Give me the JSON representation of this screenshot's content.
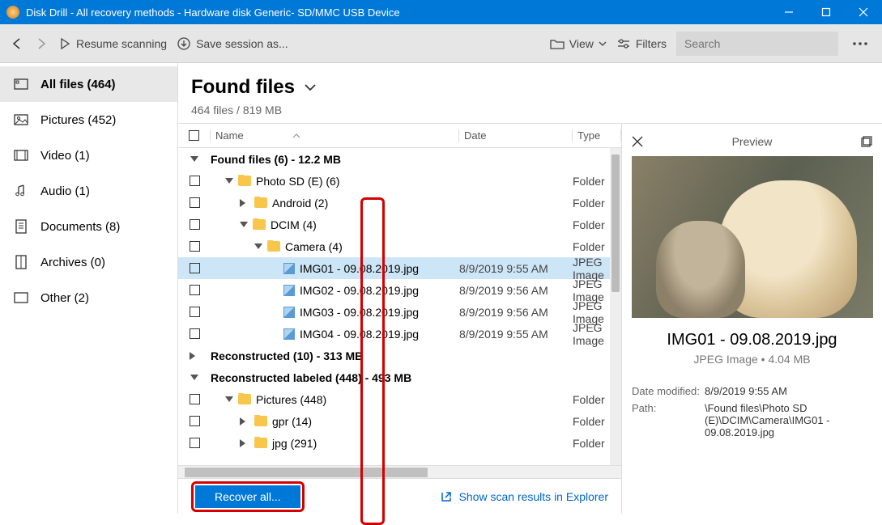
{
  "titlebar": {
    "title": "Disk Drill - All recovery methods - Hardware disk Generic- SD/MMC USB Device"
  },
  "toolbar": {
    "resume": "Resume scanning",
    "save": "Save session as...",
    "view": "View",
    "filters": "Filters",
    "search_placeholder": "Search"
  },
  "sidebar": {
    "items": [
      {
        "label": "All files (464)"
      },
      {
        "label": "Pictures (452)"
      },
      {
        "label": "Video (1)"
      },
      {
        "label": "Audio (1)"
      },
      {
        "label": "Documents (8)"
      },
      {
        "label": "Archives (0)"
      },
      {
        "label": "Other (2)"
      }
    ]
  },
  "content": {
    "title": "Found files",
    "subtitle": "464 files / 819 MB"
  },
  "columns": {
    "name": "Name",
    "date": "Date",
    "type": "Type"
  },
  "rows": [
    {
      "indent": 0,
      "kind": "group",
      "open": true,
      "name": "Found files (6) - 12.2 MB",
      "date": "",
      "type": ""
    },
    {
      "indent": 1,
      "kind": "folder",
      "open": true,
      "name": "Photo SD (E) (6)",
      "date": "",
      "type": "Folder"
    },
    {
      "indent": 2,
      "kind": "folderclosed",
      "open": false,
      "name": "Android (2)",
      "date": "",
      "type": "Folder"
    },
    {
      "indent": 2,
      "kind": "folder",
      "open": true,
      "name": "DCIM (4)",
      "date": "",
      "type": "Folder"
    },
    {
      "indent": 3,
      "kind": "folder",
      "open": true,
      "name": "Camera (4)",
      "date": "",
      "type": "Folder"
    },
    {
      "indent": 4,
      "kind": "file",
      "sel": true,
      "name": "IMG01 - 09.08.2019.jpg",
      "date": "8/9/2019 9:55 AM",
      "type": "JPEG Image"
    },
    {
      "indent": 4,
      "kind": "file",
      "name": "IMG02 - 09.08.2019.jpg",
      "date": "8/9/2019 9:56 AM",
      "type": "JPEG Image"
    },
    {
      "indent": 4,
      "kind": "file",
      "name": "IMG03 - 09.08.2019.jpg",
      "date": "8/9/2019 9:56 AM",
      "type": "JPEG Image"
    },
    {
      "indent": 4,
      "kind": "file",
      "name": "IMG04 - 09.08.2019.jpg",
      "date": "8/9/2019 9:55 AM",
      "type": "JPEG Image"
    },
    {
      "indent": 0,
      "kind": "groupclosed",
      "open": false,
      "name": "Reconstructed (10) - 313 MB",
      "date": "",
      "type": ""
    },
    {
      "indent": 0,
      "kind": "group",
      "open": true,
      "name": "Reconstructed labeled (448) - 493 MB",
      "date": "",
      "type": ""
    },
    {
      "indent": 1,
      "kind": "folder",
      "open": true,
      "name": "Pictures (448)",
      "date": "",
      "type": "Folder"
    },
    {
      "indent": 2,
      "kind": "folderclosed",
      "open": false,
      "name": "gpr (14)",
      "date": "",
      "type": "Folder"
    },
    {
      "indent": 2,
      "kind": "folderclosed",
      "open": false,
      "name": "jpg (291)",
      "date": "",
      "type": "Folder"
    }
  ],
  "bottom": {
    "recover": "Recover all...",
    "explorer": "Show scan results in Explorer"
  },
  "preview": {
    "title": "Preview",
    "filename": "IMG01 - 09.08.2019.jpg",
    "meta": "JPEG Image • 4.04 MB",
    "date_label": "Date modified:",
    "date_value": "8/9/2019 9:55 AM",
    "path_label": "Path:",
    "path_value": "\\Found files\\Photo SD (E)\\DCIM\\Camera\\IMG01 - 09.08.2019.jpg"
  }
}
